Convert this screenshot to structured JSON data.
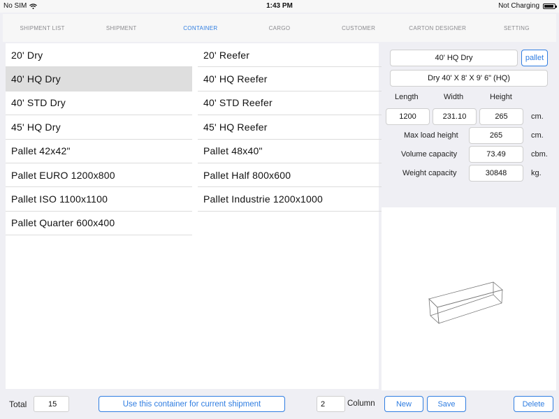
{
  "status_bar": {
    "carrier": "No SIM",
    "time": "1:43 PM",
    "charging": "Not Charging"
  },
  "tabs": [
    {
      "label": "SHIPMENT LIST",
      "active": false
    },
    {
      "label": "SHIPMENT",
      "active": false
    },
    {
      "label": "CONTAINER",
      "active": true
    },
    {
      "label": "CARGO",
      "active": false
    },
    {
      "label": "CUSTOMER",
      "active": false
    },
    {
      "label": "CARTON DESIGNER",
      "active": false
    },
    {
      "label": "SETTING",
      "active": false
    }
  ],
  "containers": {
    "left": [
      "20' Dry",
      "40' HQ Dry",
      "40' STD Dry",
      "45' HQ Dry",
      "Pallet 42x42\"",
      "Pallet EURO 1200x800",
      "Pallet ISO 1100x1100",
      "Pallet Quarter 600x400"
    ],
    "right": [
      "20' Reefer",
      "40' HQ Reefer",
      "40' STD Reefer",
      "45' HQ Reefer",
      "Pallet 48x40\"",
      "Pallet Half 800x600",
      "Pallet Industrie 1200x1000"
    ],
    "selected": "40' HQ Dry"
  },
  "detail": {
    "name": "40' HQ Dry",
    "pallet_button": "pallet",
    "description": "Dry 40' X 8' X 9' 6\" (HQ)",
    "length_label": "Length",
    "width_label": "Width",
    "height_label": "Height",
    "length": "1200",
    "width": "231.10",
    "height": "265",
    "dim_unit": "cm.",
    "max_load_label": "Max load height",
    "max_load": "265",
    "max_load_unit": "cm.",
    "volume_label": "Volume capacity",
    "volume": "73.49",
    "volume_unit": "cbm.",
    "weight_label": "Weight capacity",
    "weight": "30848",
    "weight_unit": "kg."
  },
  "bottom": {
    "total_label": "Total",
    "total": "15",
    "use_button": "Use this container for current shipment",
    "columns": "2",
    "column_label": "Column",
    "new_button": "New",
    "save_button": "Save",
    "delete_button": "Delete"
  },
  "colors": {
    "accent": "#2f7de1",
    "selected_row": "#dedede",
    "background": "#efeff4"
  },
  "icons": [
    "wifi-icon",
    "battery-icon",
    "container-3d-preview"
  ]
}
